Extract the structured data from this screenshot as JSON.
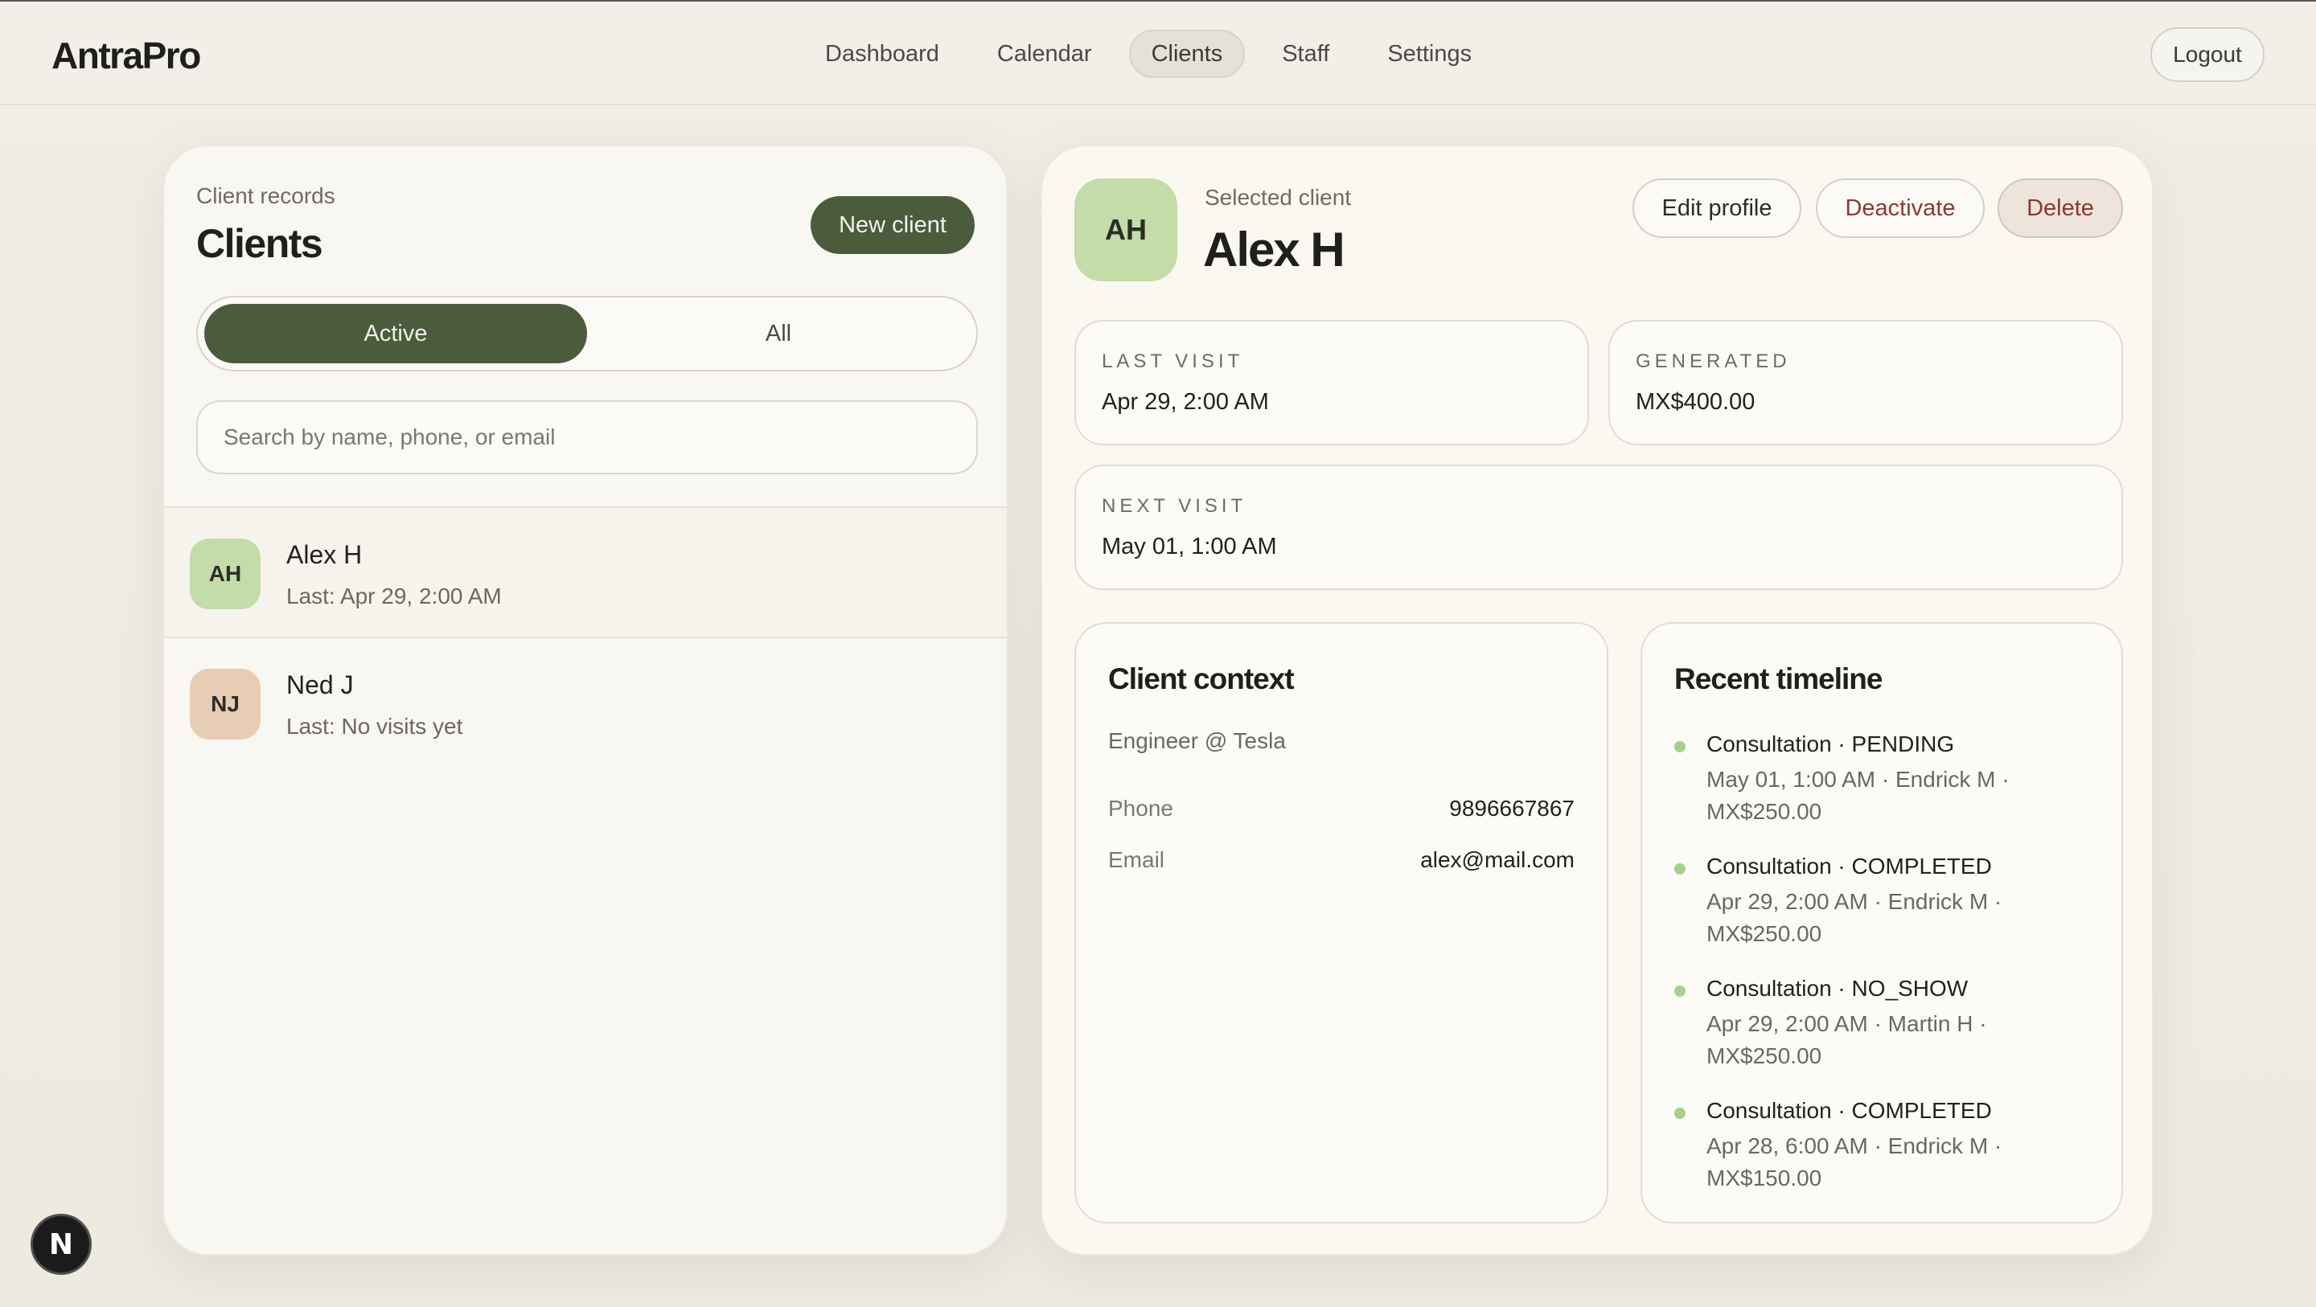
{
  "app": {
    "brand": "AntraPro"
  },
  "nav": {
    "items": [
      {
        "label": "Dashboard",
        "active": false
      },
      {
        "label": "Calendar",
        "active": false
      },
      {
        "label": "Clients",
        "active": true
      },
      {
        "label": "Staff",
        "active": false
      },
      {
        "label": "Settings",
        "active": false
      }
    ],
    "logout_label": "Logout"
  },
  "clients_panel": {
    "eyebrow": "Client records",
    "title": "Clients",
    "new_client_label": "New client",
    "filter": {
      "active_label": "Active",
      "all_label": "All",
      "selected": "Active"
    },
    "search_placeholder": "Search by name, phone, or email",
    "clients": [
      {
        "initials": "AH",
        "name": "Alex H",
        "sub": "Last: Apr 29, 2:00 AM",
        "avatar_color": "#c3dcaa",
        "selected": true
      },
      {
        "initials": "NJ",
        "name": "Ned J",
        "sub": "Last: No visits yet",
        "avatar_color": "#e6cdb4",
        "selected": false
      }
    ]
  },
  "detail": {
    "initials": "AH",
    "eyebrow": "Selected client",
    "name": "Alex H",
    "actions": {
      "edit": "Edit profile",
      "deactivate": "Deactivate",
      "delete": "Delete"
    },
    "stats": {
      "last_visit": {
        "label": "LAST VISIT",
        "value": "Apr 29, 2:00 AM"
      },
      "generated": {
        "label": "GENERATED",
        "value": "MX$400.00"
      },
      "next_visit": {
        "label": "NEXT VISIT",
        "value": "May 01, 1:00 AM"
      }
    },
    "context": {
      "title": "Client context",
      "occupation": "Engineer @ Tesla",
      "phone_label": "Phone",
      "phone": "9896667867",
      "email_label": "Email",
      "email": "alex@mail.com"
    },
    "timeline": {
      "title": "Recent timeline",
      "items": [
        {
          "title": "Consultation · PENDING",
          "meta": "May 01, 1:00 AM · Endrick M · MX$250.00"
        },
        {
          "title": "Consultation · COMPLETED",
          "meta": "Apr 29, 2:00 AM · Endrick M · MX$250.00"
        },
        {
          "title": "Consultation · NO_SHOW",
          "meta": "Apr 29, 2:00 AM · Martin H · MX$250.00"
        },
        {
          "title": "Consultation · COMPLETED",
          "meta": "Apr 28, 6:00 AM · Endrick M · MX$150.00"
        }
      ]
    }
  },
  "dev_badge": {
    "letter": "N"
  },
  "colors": {
    "accent": "#4b5c3d",
    "timeline_dot": "#a9cf8c",
    "danger_text": "#8a3a2e"
  }
}
